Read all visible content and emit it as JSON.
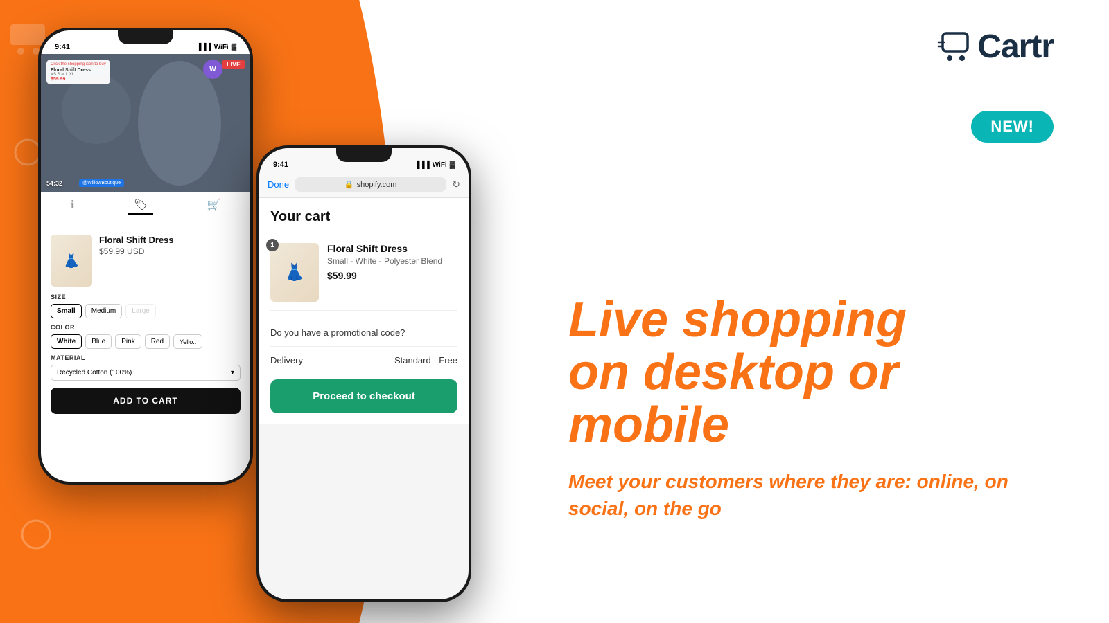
{
  "logo": {
    "text": "Cartr",
    "icon_label": "cart-logo-icon"
  },
  "badge": {
    "text": "NEW!"
  },
  "headline": {
    "line1": "Live shopping",
    "line2": "on desktop or",
    "line3": "mobile"
  },
  "subheadline": {
    "text": "Meet your customers where they are: online, on social, on the go"
  },
  "phone_back": {
    "status_time": "9:41",
    "stream": {
      "click_to_buy": "Click the shopping icon to buy",
      "product_name": "Floral Shift Dress",
      "sizes": "XS S M L XL",
      "price": "$59.99",
      "avatar_letter": "W",
      "live_badge": "LIVE",
      "time": "54:32",
      "fb_handle": "@WillowBoutique"
    },
    "nav_tabs": [
      "info",
      "tag",
      "cart"
    ],
    "product": {
      "name": "Floral Shift Dress",
      "price": "$59.99 USD",
      "size_label": "SIZE",
      "sizes": [
        "Small",
        "Medium",
        "Large"
      ],
      "selected_size": "Small",
      "color_label": "COLOR",
      "colors": [
        "White",
        "Blue",
        "Pink",
        "Red",
        "Yellow"
      ],
      "selected_color": "White",
      "material_label": "MATERIAL",
      "material_value": "Recycled Cotton (100%)",
      "add_to_cart": "ADD TO CART"
    }
  },
  "phone_front": {
    "status_time": "9:41",
    "browser": {
      "done": "Done",
      "url": "shopify.com",
      "lock_icon": "lock"
    },
    "cart": {
      "title": "Your cart",
      "item": {
        "name": "Floral Shift Dress",
        "variant": "Small - White - Polyester Blend",
        "price": "$59.99",
        "quantity": "1"
      },
      "promo": "Do you have a promotional code?",
      "delivery_label": "Delivery",
      "delivery_value": "Standard - Free",
      "checkout_btn": "Proceed to checkout"
    }
  },
  "colors": {
    "orange": "#F97316",
    "teal": "#0ab5b5",
    "dark": "#1a2e44",
    "green": "#1a9e6e"
  }
}
